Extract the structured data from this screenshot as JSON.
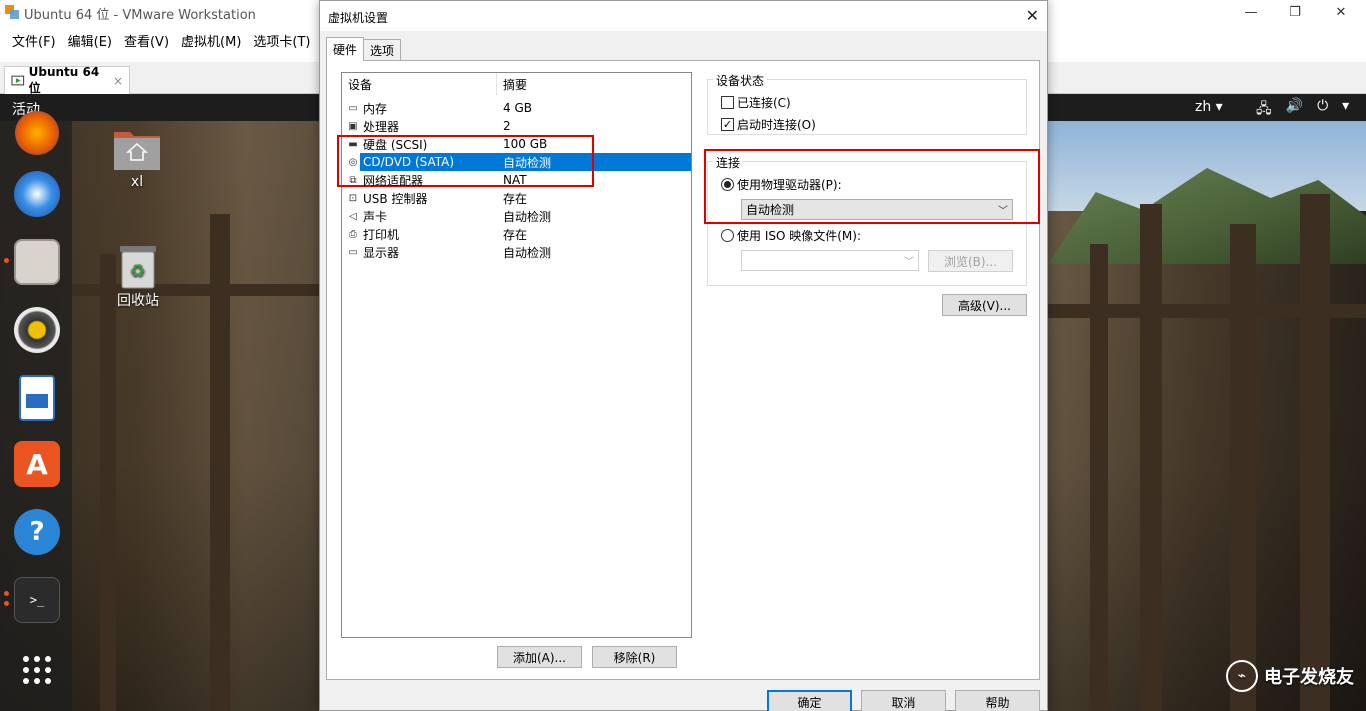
{
  "window": {
    "title": "Ubuntu 64 位 - VMware Workstation",
    "menu": [
      "文件(F)",
      "编辑(E)",
      "查看(V)",
      "虚拟机(M)",
      "选项卡(T)"
    ],
    "vm_tab": "Ubuntu 64 位",
    "vm_tab_close": "×"
  },
  "ubuntu": {
    "activities": "活动",
    "lang": "zh ▾",
    "sys_icons": [
      "network-icon",
      "volume-icon",
      "power-icon",
      "chevron-down-icon"
    ],
    "sys_glyphs": [
      "🖧",
      "🔊",
      "⏻",
      "▾"
    ],
    "desktop_icons": [
      {
        "label": "xl",
        "icon": "home-folder-icon"
      },
      {
        "label": "回收站",
        "icon": "trash-icon"
      }
    ],
    "dock": [
      "firefox-icon",
      "thunderbird-icon",
      "files-icon",
      "rhythmbox-icon",
      "writer-icon",
      "software-icon",
      "help-icon",
      "terminal-icon",
      "apps-grid-icon"
    ]
  },
  "dialog": {
    "title": "虚拟机设置",
    "close": "✕",
    "tabs": [
      "硬件",
      "选项"
    ],
    "list_headers": [
      "设备",
      "摘要"
    ],
    "devices": [
      {
        "name": "内存",
        "summary": "4 GB",
        "icon": "memory-icon",
        "glyph": "▭"
      },
      {
        "name": "处理器",
        "summary": "2",
        "icon": "cpu-icon",
        "glyph": "▣"
      },
      {
        "name": "硬盘 (SCSI)",
        "summary": "100 GB",
        "icon": "harddisk-icon",
        "glyph": "▬"
      },
      {
        "name": "CD/DVD (SATA)",
        "summary": "自动检测",
        "icon": "cdrom-icon",
        "glyph": "◎"
      },
      {
        "name": "网络适配器",
        "summary": "NAT",
        "icon": "network-adapter-icon",
        "glyph": "⧉"
      },
      {
        "name": "USB 控制器",
        "summary": "存在",
        "icon": "usb-icon",
        "glyph": "⊡"
      },
      {
        "name": "声卡",
        "summary": "自动检测",
        "icon": "sound-icon",
        "glyph": "◁"
      },
      {
        "name": "打印机",
        "summary": "存在",
        "icon": "printer-icon",
        "glyph": "⎙"
      },
      {
        "name": "显示器",
        "summary": "自动检测",
        "icon": "display-icon",
        "glyph": "▭"
      }
    ],
    "selected_index": 3,
    "add_button": "添加(A)...",
    "remove_button": "移除(R)",
    "device_status": {
      "label": "设备状态",
      "connected": "已连接(C)",
      "connected_checked": false,
      "connect_on_start": "启动时连接(O)",
      "connect_on_start_checked": true
    },
    "connection": {
      "label": "连接",
      "physical_drive": "使用物理驱动器(P):",
      "physical_selected": true,
      "physical_value": "自动检测",
      "iso": "使用 ISO 映像文件(M):",
      "iso_value": "",
      "browse": "浏览(B)..."
    },
    "advanced": "高级(V)...",
    "ok": "确定",
    "cancel": "取消",
    "help": "帮助"
  },
  "watermark": "电子发烧友"
}
